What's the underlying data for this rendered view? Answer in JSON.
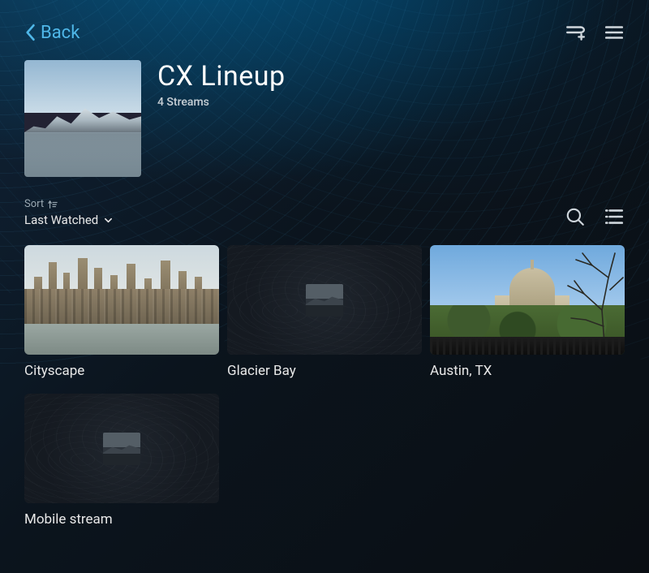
{
  "nav": {
    "back_label": "Back"
  },
  "header": {
    "title": "CX Lineup",
    "subtitle": "4 Streams"
  },
  "sort": {
    "label": "Sort",
    "value": "Last Watched"
  },
  "streams": [
    {
      "label": "Cityscape"
    },
    {
      "label": "Glacier Bay"
    },
    {
      "label": "Austin, TX"
    },
    {
      "label": "Mobile stream"
    }
  ]
}
